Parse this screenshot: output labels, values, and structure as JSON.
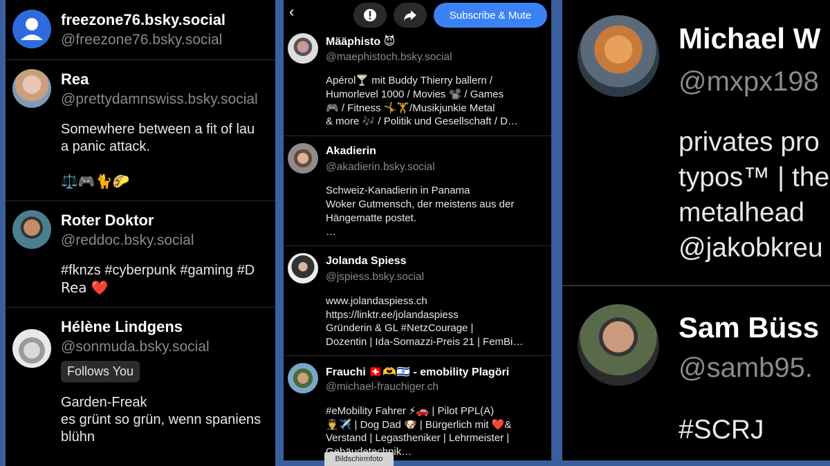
{
  "panel1": {
    "users": [
      {
        "name": "freezone76.bsky.social",
        "handle": "@freezone76.bsky.social",
        "avatar": "default-user-avatar"
      },
      {
        "name": "Rea",
        "handle": "@prettydamnswiss.bsky.social",
        "bio1": "Somewhere between a fit of lau",
        "bio2": "a panic attack.",
        "bio3": "⚖️🎮🐈🌮"
      },
      {
        "name": "Roter Doktor",
        "handle": "@reddoc.bsky.social",
        "bio1": "#fknzs #cyberpunk #gaming #D",
        "bio2": "Rea ❤️"
      },
      {
        "name": "Hélène Lindgens",
        "handle": "@sonmuda.bsky.social",
        "badge": "Follows You",
        "bio1": "Garden-Freak",
        "bio2": "es grünt so grün, wenn spaniens",
        "bio3": "blühn"
      }
    ]
  },
  "panel2": {
    "toolbar": {
      "back_icon": "‹",
      "alert_icon": "!",
      "share_icon": "↪",
      "subscribe_label": "Subscribe & Mute"
    },
    "users": [
      {
        "name": "Määphisto 😈",
        "handle": "@maephistoch.bsky.social",
        "bio": [
          "Apérol🍸  mit Buddy Thierry ballern  /",
          "Humorlevel 1000 / Movies 📽️ / Games",
          "🎮 / Fitness 🤸🏋️/Musikjunkie Metal",
          "& more 🎶 / Politik und Gesellschaft / D…"
        ]
      },
      {
        "name": "Akadierin",
        "handle": "@akadierin.bsky.social",
        "bio": [
          "Schweiz-Kanadierin in Panama",
          "Woker Gutmensch, der meistens aus der",
          "Hängematte postet.",
          "…"
        ]
      },
      {
        "name": "Jolanda Spiess",
        "handle": "@jspiess.bsky.social",
        "bio": [
          "www.jolandaspiess.ch",
          "https://linktr.ee/jolandaspiess",
          "Gründerin & GL #NetzCourage |",
          "Dozentin | Ida-Somazzi-Preis 21 | FemBi…"
        ]
      },
      {
        "name": "Frauchi 🇨🇭🫶🇮🇱 - emobility Plagöri",
        "handle": "@michael-frauchiger.ch",
        "bio": [
          "#eMobility Fahrer ⚡🚗 | Pilot PPL(A)",
          "👨‍✈️✈️ | Dog Dad 🐶 | Bürgerlich mit ❤️&",
          "Verstand | Legastheniker | Lehrmeister |",
          "Gebäudetechnik…"
        ]
      }
    ],
    "tooltip": "Bildschirmfoto"
  },
  "panel3": {
    "users": [
      {
        "name": "Michael W",
        "handle": "@mxpx198",
        "bio": [
          "privates pro",
          "typos™ | the",
          "metalhead",
          "@jakobkreu"
        ]
      },
      {
        "name": "Sam Büss",
        "handle": "@samb95.",
        "bio": [
          "#SCRJ"
        ]
      }
    ]
  },
  "colors": {
    "background": "#000000",
    "frame": "#3a5f9e",
    "accent": "#3b82f6",
    "handle": "#8a8a8a"
  }
}
